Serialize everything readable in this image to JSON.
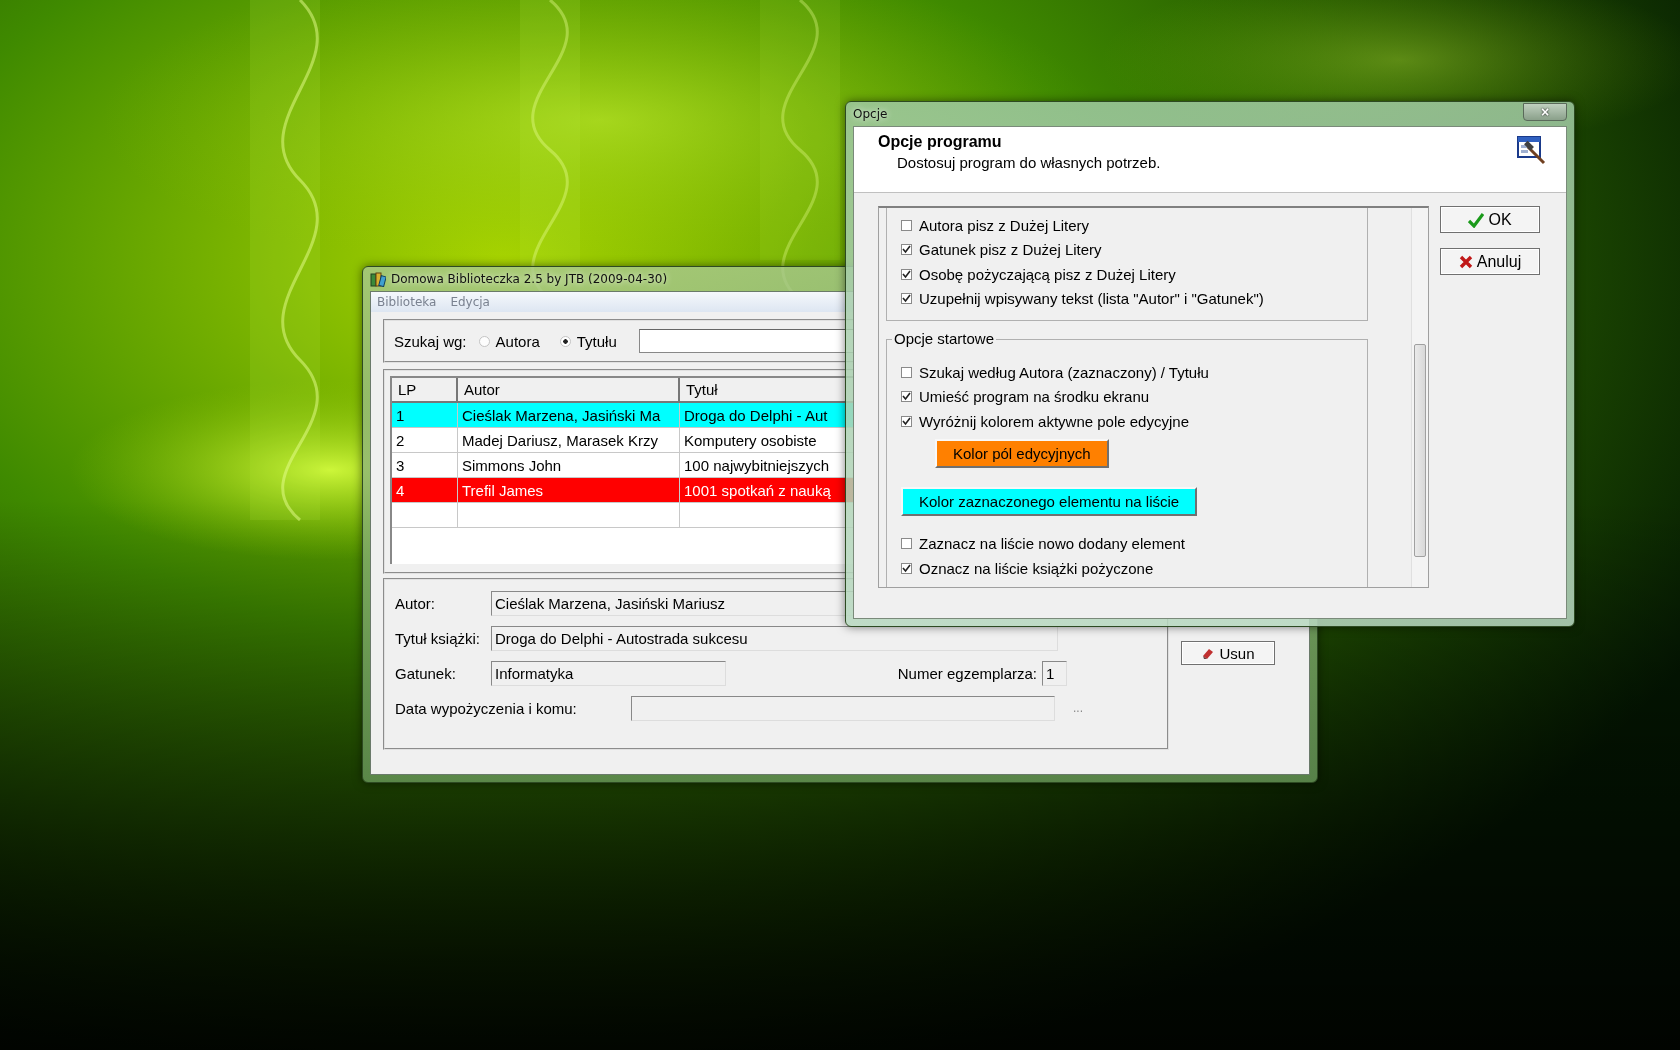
{
  "main_window": {
    "title": "Domowa Biblioteczka 2.5 by JTB (2009-04-30)",
    "menu": [
      "Biblioteka",
      "Edycja"
    ],
    "search": {
      "label": "Szukaj wg:",
      "options": [
        {
          "label": "Autora",
          "selected": false
        },
        {
          "label": "Tytułu",
          "selected": true
        }
      ]
    },
    "table": {
      "columns": [
        "LP",
        "Autor",
        "Tytuł"
      ],
      "rows": [
        {
          "cells": [
            "1",
            "Cieślak Marzena, Jasiński Ma",
            "Droga do Delphi - Aut"
          ],
          "selected": true,
          "borrowed": false
        },
        {
          "cells": [
            "2",
            "Madej Dariusz, Marasek Krzy",
            "Komputery osobiste"
          ],
          "selected": false,
          "borrowed": false
        },
        {
          "cells": [
            "3",
            "Simmons John",
            "100 najwybitniejszych"
          ],
          "selected": false,
          "borrowed": false
        },
        {
          "cells": [
            "4",
            "Trefil James",
            "1001 spotkań z nauką"
          ],
          "selected": false,
          "borrowed": true
        }
      ]
    },
    "form": {
      "author": {
        "label": "Autor:",
        "value": "Cieślak Marzena, Jasiński Mariusz"
      },
      "title": {
        "label": "Tytuł książki:",
        "value": "Droga do Delphi - Autostrada sukcesu"
      },
      "genre": {
        "label": "Gatunek:",
        "value": "Informatyka"
      },
      "copy_number": {
        "label": "Numer egzemplarza:",
        "value": "1"
      },
      "loan": {
        "label": "Data wypożyczenia i komu:",
        "browse_button": "..."
      }
    },
    "buttons": [
      "Usun"
    ]
  },
  "options_dialog": {
    "title": "Opcje",
    "close": "×",
    "header_title": "Opcje programu",
    "header_subtitle": "Dostosuj program do własnych potrzeb.",
    "sections": [
      {
        "items": [
          {
            "kind": "checkbox",
            "label": "Autora pisz z Dużej Litery",
            "checked": false
          },
          {
            "kind": "checkbox",
            "label": "Gatunek pisz z Dużej Litery",
            "checked": true
          },
          {
            "kind": "checkbox",
            "label": "Osobę pożyczającą pisz z Dużej Litery",
            "checked": true
          },
          {
            "kind": "checkbox",
            "label": "Uzupełnij wpisywany tekst (lista \"Autor\" i \"Gatunek\")",
            "checked": true
          }
        ]
      },
      {
        "title": "Opcje startowe",
        "items": [
          {
            "kind": "checkbox",
            "label": "Szukaj według Autora (zaznaczony) / Tytułu",
            "checked": false
          },
          {
            "kind": "checkbox",
            "label": "Umieść program na środku ekranu",
            "checked": true
          },
          {
            "kind": "checkbox",
            "label": "Wyróżnij kolorem aktywne pole edycyjne",
            "checked": true,
            "color_button": {
              "label": "Kolor pól edycyjnych",
              "color": "#ff8000"
            }
          },
          {
            "kind": "color_button",
            "label": "Kolor zaznaczonego elementu na liście",
            "color": "#00ffff"
          },
          {
            "kind": "checkbox",
            "label": "Zaznacz na liście nowo dodany element",
            "checked": false
          },
          {
            "kind": "checkbox",
            "label": "Oznacz na liście książki pożyczone",
            "checked": true
          }
        ]
      }
    ],
    "buttons": [
      {
        "kind": "ok",
        "label": "OK"
      },
      {
        "kind": "cancel",
        "label": "Anuluj"
      }
    ]
  }
}
